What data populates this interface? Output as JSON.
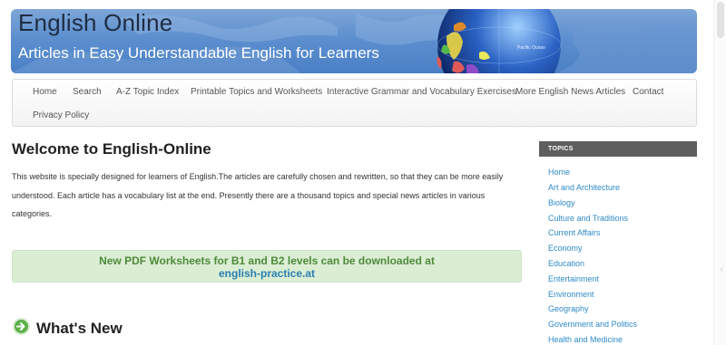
{
  "header": {
    "title": "English Online",
    "subtitle": "Articles in Easy Understandable English for Learners",
    "globe_label": "Pacific Ocean"
  },
  "nav": {
    "items": [
      "Home",
      "Search",
      "A-Z Topic Index",
      "Printable Topics and Worksheets",
      "Interactive Grammar and Vocabulary Exercises",
      "More English News Articles",
      "Contact",
      "Privacy Policy"
    ]
  },
  "main": {
    "title": "Welcome to English-Online",
    "intro": "This website is specially designed for learners of English.The articles are carefully chosen and rewritten, so that they can be more easily understood. Each article has a vocabulary list at the end. Presently there are a thousand topics and special news articles in various categories.",
    "notice": {
      "line1": "New PDF Worksheets for B1 and B2 levels can be downloaded at",
      "link": "english-practice.at"
    },
    "whats_new": "What's New"
  },
  "sidebar": {
    "header": "TOPICS",
    "items": [
      "Home",
      "Art and Architecture",
      "Biology",
      "Culture and Traditions",
      "Current Affairs",
      "Economy",
      "Education",
      "Entertainment",
      "Environment",
      "Geography",
      "Government and Politics",
      "Health and Medicine"
    ]
  },
  "colors": {
    "link": "#2e8bc7",
    "notice_bg": "#dbeed4",
    "notice_text": "#4e8a3a",
    "topics_header_bg": "#5e5e5e"
  }
}
